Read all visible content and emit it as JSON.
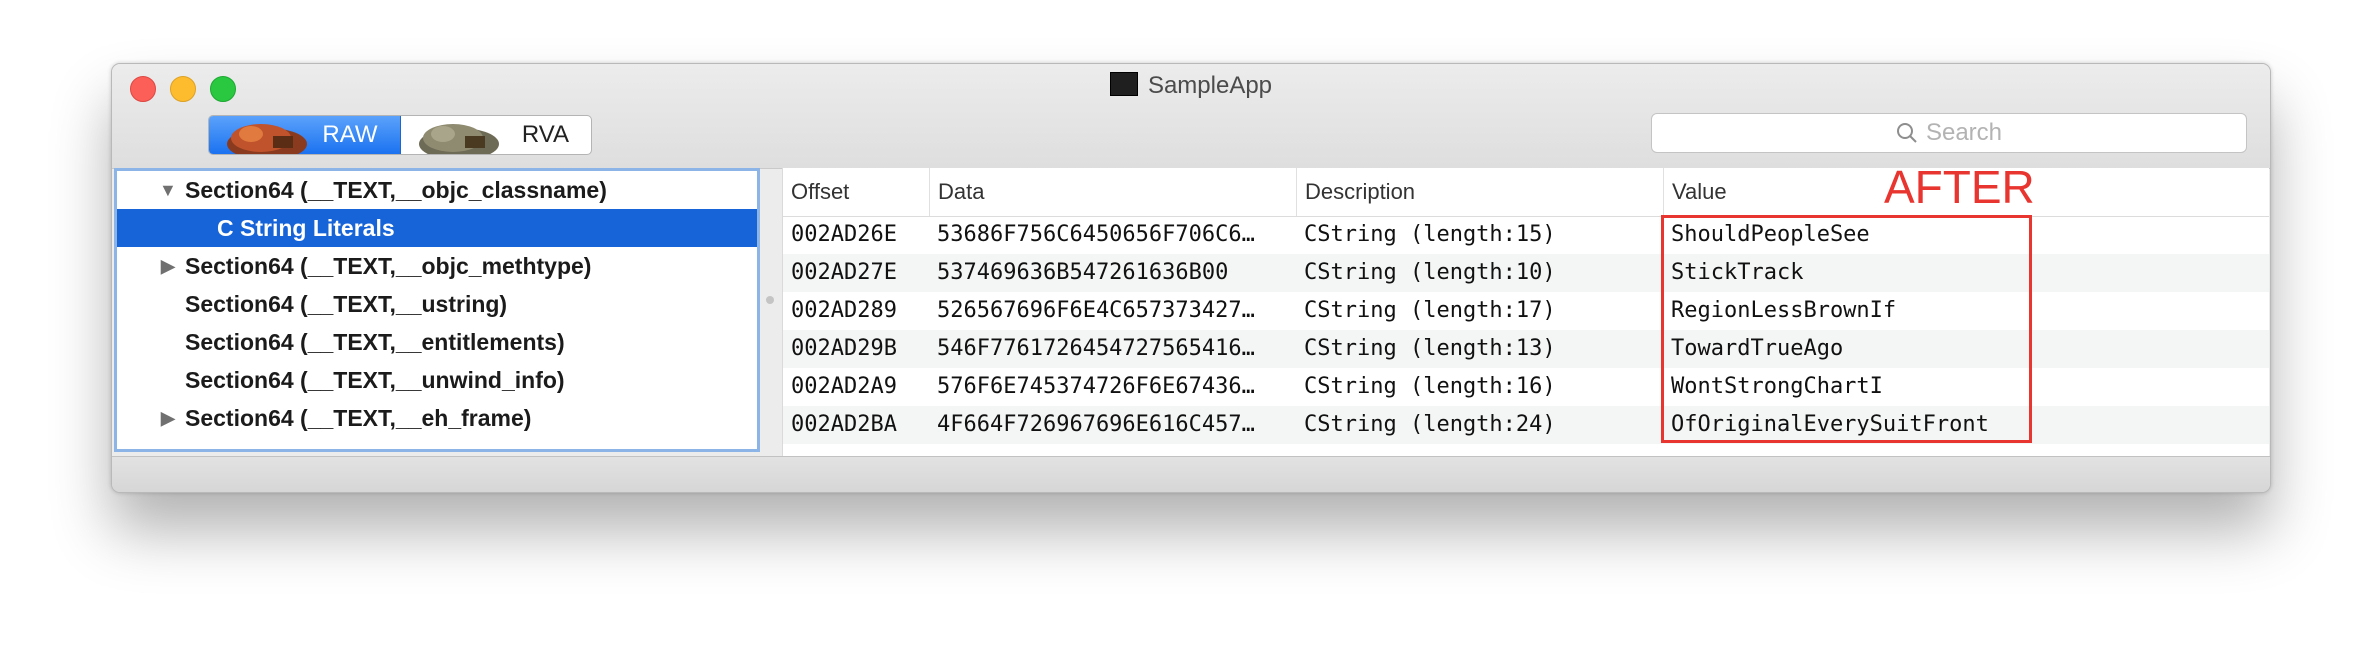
{
  "window": {
    "title": "SampleApp"
  },
  "toolbar": {
    "segments": [
      {
        "label": "RAW",
        "icon": "raw-icon"
      },
      {
        "label": "RVA",
        "icon": "rva-icon"
      }
    ],
    "search_placeholder": "Search"
  },
  "outline": {
    "items": [
      {
        "label": "Section64 (__TEXT,__objc_classname)",
        "disclosure": "expanded"
      },
      {
        "label": "C String Literals",
        "selected": true
      },
      {
        "label": "Section64 (__TEXT,__objc_methtype)",
        "disclosure": "collapsed"
      },
      {
        "label": "Section64 (__TEXT,__ustring)"
      },
      {
        "label": "Section64 (__TEXT,__entitlements)"
      },
      {
        "label": "Section64 (__TEXT,__unwind_info)"
      },
      {
        "label": "Section64 (__TEXT,__eh_frame)",
        "disclosure": "collapsed"
      }
    ]
  },
  "table": {
    "columns": [
      "Offset",
      "Data",
      "Description",
      "Value"
    ],
    "rows": [
      [
        "002AD26E",
        "53686F756C6450656F706C6…",
        "CString (length:15)",
        "ShouldPeopleSee"
      ],
      [
        "002AD27E",
        "537469636B547261636B00",
        "CString (length:10)",
        "StickTrack"
      ],
      [
        "002AD289",
        "526567696F6E4C657373427…",
        "CString (length:17)",
        "RegionLessBrownIf"
      ],
      [
        "002AD29B",
        "546F7761726454727565416…",
        "CString (length:13)",
        "TowardTrueAgo"
      ],
      [
        "002AD2A9",
        "576F6E745374726F6E67436…",
        "CString (length:16)",
        "WontStrongChartI"
      ],
      [
        "002AD2BA",
        "4F664F726967696E616C457…",
        "CString (length:24)",
        "OfOriginalEverySuitFront"
      ]
    ]
  },
  "annotation": {
    "label": "AFTER",
    "color": "#e8352f"
  }
}
